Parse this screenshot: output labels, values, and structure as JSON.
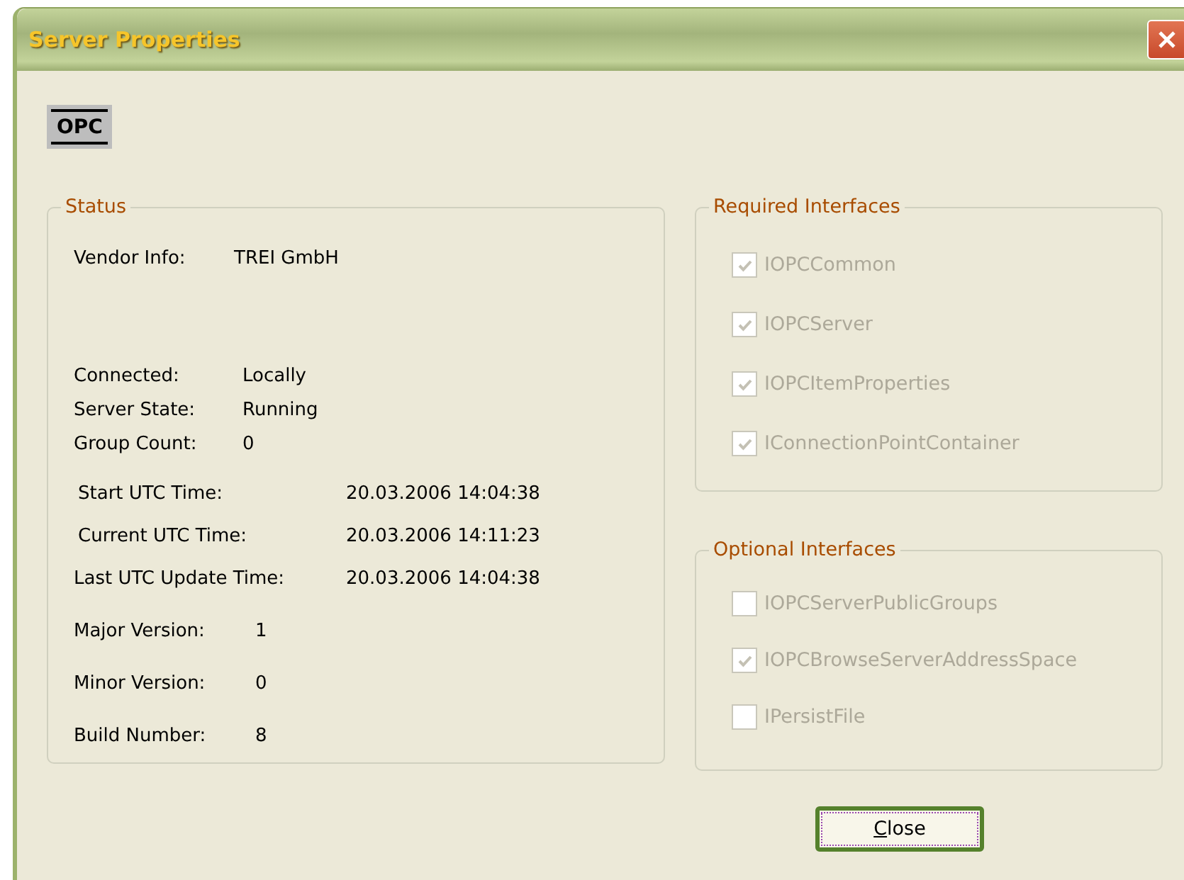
{
  "window": {
    "title": "Server Properties"
  },
  "logo": {
    "text": "OPC"
  },
  "status": {
    "title": "Status",
    "vendor": {
      "label": "Vendor Info:",
      "value": "TREI GmbH"
    },
    "connection": [
      {
        "label": "Connected:",
        "value": "Locally"
      },
      {
        "label": "Server State:",
        "value": "Running"
      },
      {
        "label": "Group Count:",
        "value": "0"
      }
    ],
    "times": [
      {
        "label": "Start UTC Time:",
        "value": "20.03.2006 14:04:38"
      },
      {
        "label": "Current UTC Time:",
        "value": "20.03.2006 14:11:23"
      },
      {
        "label": "Last UTC Update Time:",
        "value": "20.03.2006 14:04:38"
      }
    ],
    "versions": [
      {
        "label": "Major Version:",
        "value": "1"
      },
      {
        "label": "Minor Version:",
        "value": "0"
      },
      {
        "label": "Build Number:",
        "value": "8"
      }
    ]
  },
  "required_interfaces": {
    "title": "Required Interfaces",
    "items": [
      {
        "label": "IOPCCommon",
        "checked": true
      },
      {
        "label": "IOPCServer",
        "checked": true
      },
      {
        "label": "IOPCItemProperties",
        "checked": true
      },
      {
        "label": "IConnectionPointContainer",
        "checked": true
      }
    ]
  },
  "optional_interfaces": {
    "title": "Optional Interfaces",
    "items": [
      {
        "label": "IOPCServerPublicGroups",
        "checked": false
      },
      {
        "label": "IOPCBrowseServerAddressSpace",
        "checked": true
      },
      {
        "label": "IPersistFile",
        "checked": false
      }
    ]
  },
  "buttons": [
    {
      "label": "Close"
    }
  ]
}
